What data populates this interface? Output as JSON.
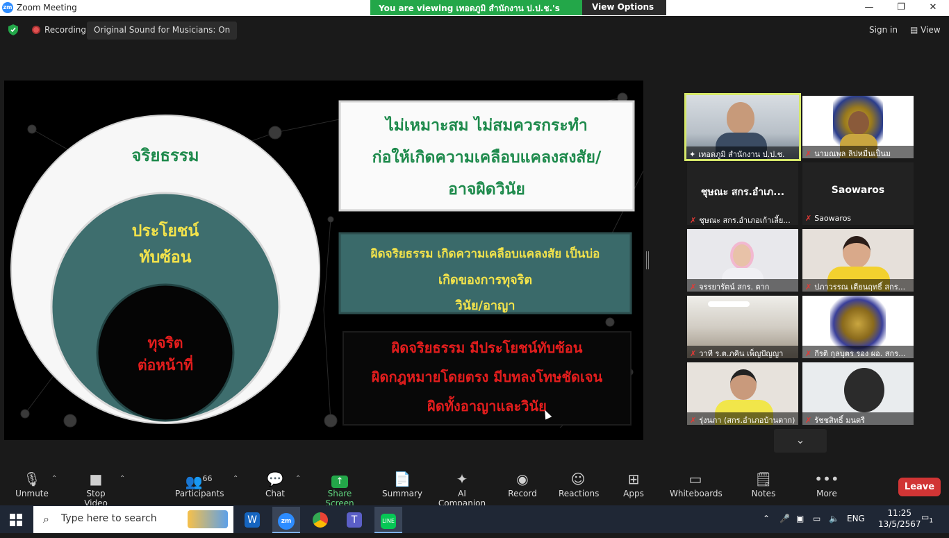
{
  "window": {
    "title": "Zoom Meeting",
    "logo_text": "zm",
    "controls": [
      "—",
      "❐",
      "✕"
    ]
  },
  "share_banner": {
    "viewing_text": "You are viewing เทอดภูมิ สำนักงาน ป.ป.ช.'s screen",
    "view_options_label": "View Options"
  },
  "top_bar": {
    "recording_label": "Recording",
    "original_sound_label": "Original Sound for Musicians: On",
    "sign_in_label": "Sign in",
    "view_label": "View"
  },
  "slide": {
    "circle_outer_label": "จริยธรรม",
    "circle_middle_label_line1": "ประโยชน์",
    "circle_middle_label_line2": "ทับซ้อน",
    "circle_inner_label_line1": "ทุจริต",
    "circle_inner_label_line2": "ต่อหน้าที่",
    "box1_line1": "ไม่เหมาะสม ไม่สมควรกระทำ",
    "box1_line2": "ก่อให้เกิดความเคลือบแคลงสงสัย/",
    "box1_line3": "อาจผิดวินัย",
    "box2_line1": "ผิดจริยธรรม เกิดความเคลือบแคลงสัย เป็นบ่อ",
    "box2_line2": "เกิดของการทุจริต",
    "box2_line3": "วินัย/อาญา",
    "box3_line1": "ผิดจริยธรรม มีประโยชน์ทับซ้อน",
    "box3_line2": "ผิดกฎหมายโดยตรง มีบทลงโทษชัดเจน",
    "box3_line3": "ผิดทั้งอาญาและวินัย",
    "colors": {
      "green_text": "#1e8a4c",
      "yellow_text": "#f3e34b",
      "red_text": "#e31d1d",
      "teal_fill": "#3b6b6b"
    }
  },
  "participants": [
    {
      "name": "เทอดภูมิ สำนักงาน ป.ป.ช.",
      "video": true,
      "active_speaker": true,
      "muted": false
    },
    {
      "name": "นามณพล ลิปหมื่นเป็นม",
      "video": true,
      "active_speaker": false,
      "muted": true
    },
    {
      "name": "ชุษณะ สกร.อำเภอเก้าเลี้ย...",
      "display_big": "ชุษณะ สกร.อำเภ...",
      "video": false,
      "muted": true
    },
    {
      "name": "Saowaros",
      "display_big": "Saowaros",
      "video": false,
      "muted": true
    },
    {
      "name": "จรรยารัตน์ สกร. ตาก",
      "video": true,
      "muted": true
    },
    {
      "name": "ปภาวรรณ เตียนฤทธิ์ สกร...",
      "video": true,
      "muted": true
    },
    {
      "name": "วาที ร.ต.ภคิน เพ็ญปัญญา",
      "video": true,
      "muted": true
    },
    {
      "name": "กีรติ กุลบุตร รอง ผอ. สกร...",
      "video": true,
      "muted": true
    },
    {
      "name": "รุ่งนภา (สกร.อำเภอบ้านตาก)",
      "video": true,
      "muted": true
    },
    {
      "name": "รัชชสิทธิ์ มนตรี",
      "video": true,
      "muted": false
    }
  ],
  "toolbar": {
    "unmute": "Unmute",
    "stop_video": "Stop Video",
    "participants": "Participants",
    "participants_count": "66",
    "chat": "Chat",
    "share_screen": "Share Screen",
    "summary": "Summary",
    "ai_companion": "AI Companion",
    "record": "Record",
    "reactions": "Reactions",
    "apps": "Apps",
    "whiteboards": "Whiteboards",
    "notes": "Notes",
    "more": "More",
    "leave": "Leave"
  },
  "taskbar": {
    "search_placeholder": "Type here to search",
    "language": "ENG",
    "time": "11:25",
    "date": "13/5/2567",
    "notification_count": "1"
  }
}
